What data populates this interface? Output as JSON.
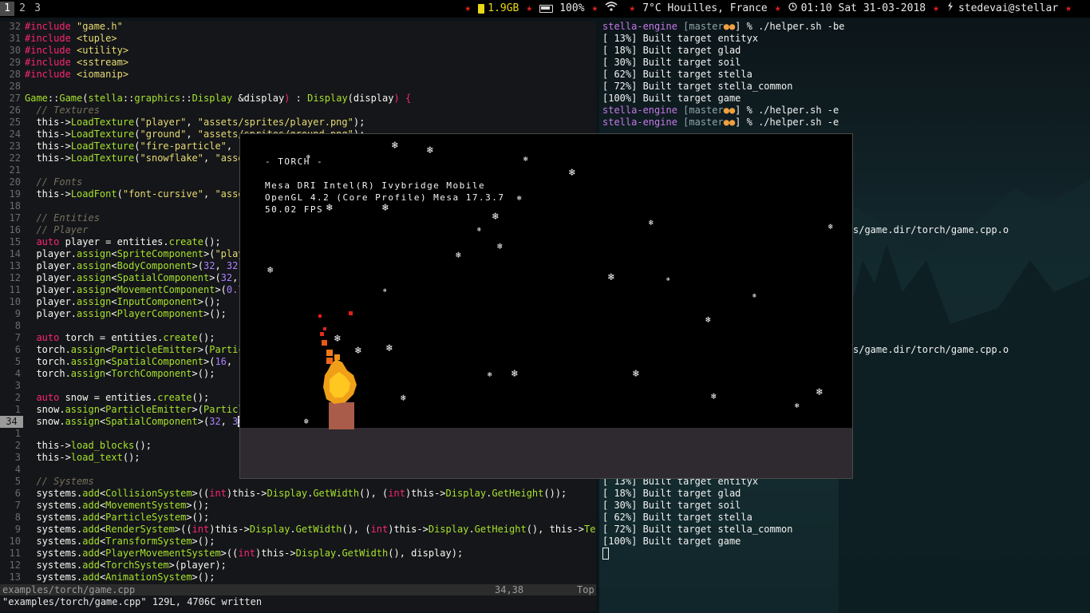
{
  "topbar": {
    "workspaces": [
      "1",
      "2",
      "3"
    ],
    "memory": "1.9GB",
    "battery": "100%",
    "weather": "7°C Houilles, France",
    "datetime": "01:10 Sat 31-03-2018",
    "user": "stedevai@stellar",
    "separator": "★"
  },
  "editor": {
    "filename": "examples/torch/game.cpp",
    "cursor_pos": "34,38",
    "scroll": "Top",
    "message": "\"examples/torch/game.cpp\" 129L, 4706C written"
  },
  "game": {
    "title": "- TORCH -",
    "renderer": "Mesa DRI Intel(R) Ivybridge Mobile",
    "gl_version": "OpenGL 4.2 (Core Profile) Mesa 17.3.7",
    "fps": "50.02 FPS"
  },
  "terminal": {
    "prompt_name": "stella-engine",
    "branch_prefix": " [master",
    "branch_dots": "●●",
    "branch_suffix": "] % ",
    "cmd_be": "./helper.sh -be",
    "cmd_e": "./helper.sh -e",
    "partial_1": "s/game.dir/torch/game.cpp.o",
    "partial_2": "s/game.dir/torch/game.cpp.o",
    "build_a": [
      "[ 13%] Built target entityx",
      "[ 18%] Built target glad",
      "[ 30%] Built target soil",
      "[ 62%] Built target stella",
      "[ 72%] Built target stella_common",
      "[100%] Built target game"
    ],
    "build_b": [
      "[ 13%] Built target entityx",
      "[ 18%] Built target glad",
      "[ 30%] Built target soil",
      "[ 62%] Built target stella",
      "[ 72%] Built target stella_common",
      "[100%] Built target game"
    ]
  }
}
